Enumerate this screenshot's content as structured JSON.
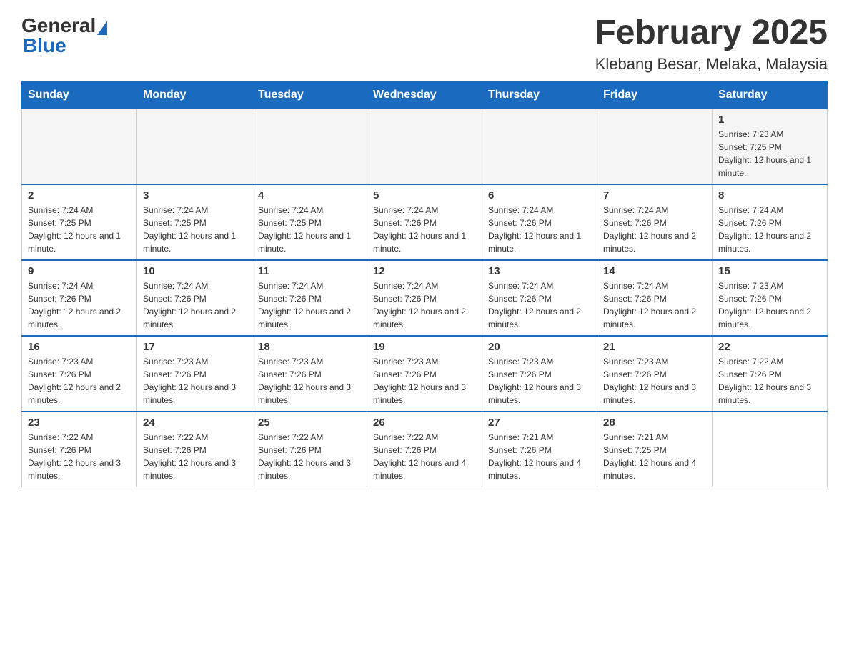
{
  "header": {
    "logo_general": "General",
    "logo_blue": "Blue",
    "title": "February 2025",
    "subtitle": "Klebang Besar, Melaka, Malaysia"
  },
  "days_of_week": [
    "Sunday",
    "Monday",
    "Tuesday",
    "Wednesday",
    "Thursday",
    "Friday",
    "Saturday"
  ],
  "weeks": [
    {
      "cells": [
        {
          "day": "",
          "sunrise": "",
          "sunset": "",
          "daylight": ""
        },
        {
          "day": "",
          "sunrise": "",
          "sunset": "",
          "daylight": ""
        },
        {
          "day": "",
          "sunrise": "",
          "sunset": "",
          "daylight": ""
        },
        {
          "day": "",
          "sunrise": "",
          "sunset": "",
          "daylight": ""
        },
        {
          "day": "",
          "sunrise": "",
          "sunset": "",
          "daylight": ""
        },
        {
          "day": "",
          "sunrise": "",
          "sunset": "",
          "daylight": ""
        },
        {
          "day": "1",
          "sunrise": "Sunrise: 7:23 AM",
          "sunset": "Sunset: 7:25 PM",
          "daylight": "Daylight: 12 hours and 1 minute."
        }
      ]
    },
    {
      "cells": [
        {
          "day": "2",
          "sunrise": "Sunrise: 7:24 AM",
          "sunset": "Sunset: 7:25 PM",
          "daylight": "Daylight: 12 hours and 1 minute."
        },
        {
          "day": "3",
          "sunrise": "Sunrise: 7:24 AM",
          "sunset": "Sunset: 7:25 PM",
          "daylight": "Daylight: 12 hours and 1 minute."
        },
        {
          "day": "4",
          "sunrise": "Sunrise: 7:24 AM",
          "sunset": "Sunset: 7:25 PM",
          "daylight": "Daylight: 12 hours and 1 minute."
        },
        {
          "day": "5",
          "sunrise": "Sunrise: 7:24 AM",
          "sunset": "Sunset: 7:26 PM",
          "daylight": "Daylight: 12 hours and 1 minute."
        },
        {
          "day": "6",
          "sunrise": "Sunrise: 7:24 AM",
          "sunset": "Sunset: 7:26 PM",
          "daylight": "Daylight: 12 hours and 1 minute."
        },
        {
          "day": "7",
          "sunrise": "Sunrise: 7:24 AM",
          "sunset": "Sunset: 7:26 PM",
          "daylight": "Daylight: 12 hours and 2 minutes."
        },
        {
          "day": "8",
          "sunrise": "Sunrise: 7:24 AM",
          "sunset": "Sunset: 7:26 PM",
          "daylight": "Daylight: 12 hours and 2 minutes."
        }
      ]
    },
    {
      "cells": [
        {
          "day": "9",
          "sunrise": "Sunrise: 7:24 AM",
          "sunset": "Sunset: 7:26 PM",
          "daylight": "Daylight: 12 hours and 2 minutes."
        },
        {
          "day": "10",
          "sunrise": "Sunrise: 7:24 AM",
          "sunset": "Sunset: 7:26 PM",
          "daylight": "Daylight: 12 hours and 2 minutes."
        },
        {
          "day": "11",
          "sunrise": "Sunrise: 7:24 AM",
          "sunset": "Sunset: 7:26 PM",
          "daylight": "Daylight: 12 hours and 2 minutes."
        },
        {
          "day": "12",
          "sunrise": "Sunrise: 7:24 AM",
          "sunset": "Sunset: 7:26 PM",
          "daylight": "Daylight: 12 hours and 2 minutes."
        },
        {
          "day": "13",
          "sunrise": "Sunrise: 7:24 AM",
          "sunset": "Sunset: 7:26 PM",
          "daylight": "Daylight: 12 hours and 2 minutes."
        },
        {
          "day": "14",
          "sunrise": "Sunrise: 7:24 AM",
          "sunset": "Sunset: 7:26 PM",
          "daylight": "Daylight: 12 hours and 2 minutes."
        },
        {
          "day": "15",
          "sunrise": "Sunrise: 7:23 AM",
          "sunset": "Sunset: 7:26 PM",
          "daylight": "Daylight: 12 hours and 2 minutes."
        }
      ]
    },
    {
      "cells": [
        {
          "day": "16",
          "sunrise": "Sunrise: 7:23 AM",
          "sunset": "Sunset: 7:26 PM",
          "daylight": "Daylight: 12 hours and 2 minutes."
        },
        {
          "day": "17",
          "sunrise": "Sunrise: 7:23 AM",
          "sunset": "Sunset: 7:26 PM",
          "daylight": "Daylight: 12 hours and 3 minutes."
        },
        {
          "day": "18",
          "sunrise": "Sunrise: 7:23 AM",
          "sunset": "Sunset: 7:26 PM",
          "daylight": "Daylight: 12 hours and 3 minutes."
        },
        {
          "day": "19",
          "sunrise": "Sunrise: 7:23 AM",
          "sunset": "Sunset: 7:26 PM",
          "daylight": "Daylight: 12 hours and 3 minutes."
        },
        {
          "day": "20",
          "sunrise": "Sunrise: 7:23 AM",
          "sunset": "Sunset: 7:26 PM",
          "daylight": "Daylight: 12 hours and 3 minutes."
        },
        {
          "day": "21",
          "sunrise": "Sunrise: 7:23 AM",
          "sunset": "Sunset: 7:26 PM",
          "daylight": "Daylight: 12 hours and 3 minutes."
        },
        {
          "day": "22",
          "sunrise": "Sunrise: 7:22 AM",
          "sunset": "Sunset: 7:26 PM",
          "daylight": "Daylight: 12 hours and 3 minutes."
        }
      ]
    },
    {
      "cells": [
        {
          "day": "23",
          "sunrise": "Sunrise: 7:22 AM",
          "sunset": "Sunset: 7:26 PM",
          "daylight": "Daylight: 12 hours and 3 minutes."
        },
        {
          "day": "24",
          "sunrise": "Sunrise: 7:22 AM",
          "sunset": "Sunset: 7:26 PM",
          "daylight": "Daylight: 12 hours and 3 minutes."
        },
        {
          "day": "25",
          "sunrise": "Sunrise: 7:22 AM",
          "sunset": "Sunset: 7:26 PM",
          "daylight": "Daylight: 12 hours and 3 minutes."
        },
        {
          "day": "26",
          "sunrise": "Sunrise: 7:22 AM",
          "sunset": "Sunset: 7:26 PM",
          "daylight": "Daylight: 12 hours and 4 minutes."
        },
        {
          "day": "27",
          "sunrise": "Sunrise: 7:21 AM",
          "sunset": "Sunset: 7:26 PM",
          "daylight": "Daylight: 12 hours and 4 minutes."
        },
        {
          "day": "28",
          "sunrise": "Sunrise: 7:21 AM",
          "sunset": "Sunset: 7:25 PM",
          "daylight": "Daylight: 12 hours and 4 minutes."
        },
        {
          "day": "",
          "sunrise": "",
          "sunset": "",
          "daylight": ""
        }
      ]
    }
  ]
}
